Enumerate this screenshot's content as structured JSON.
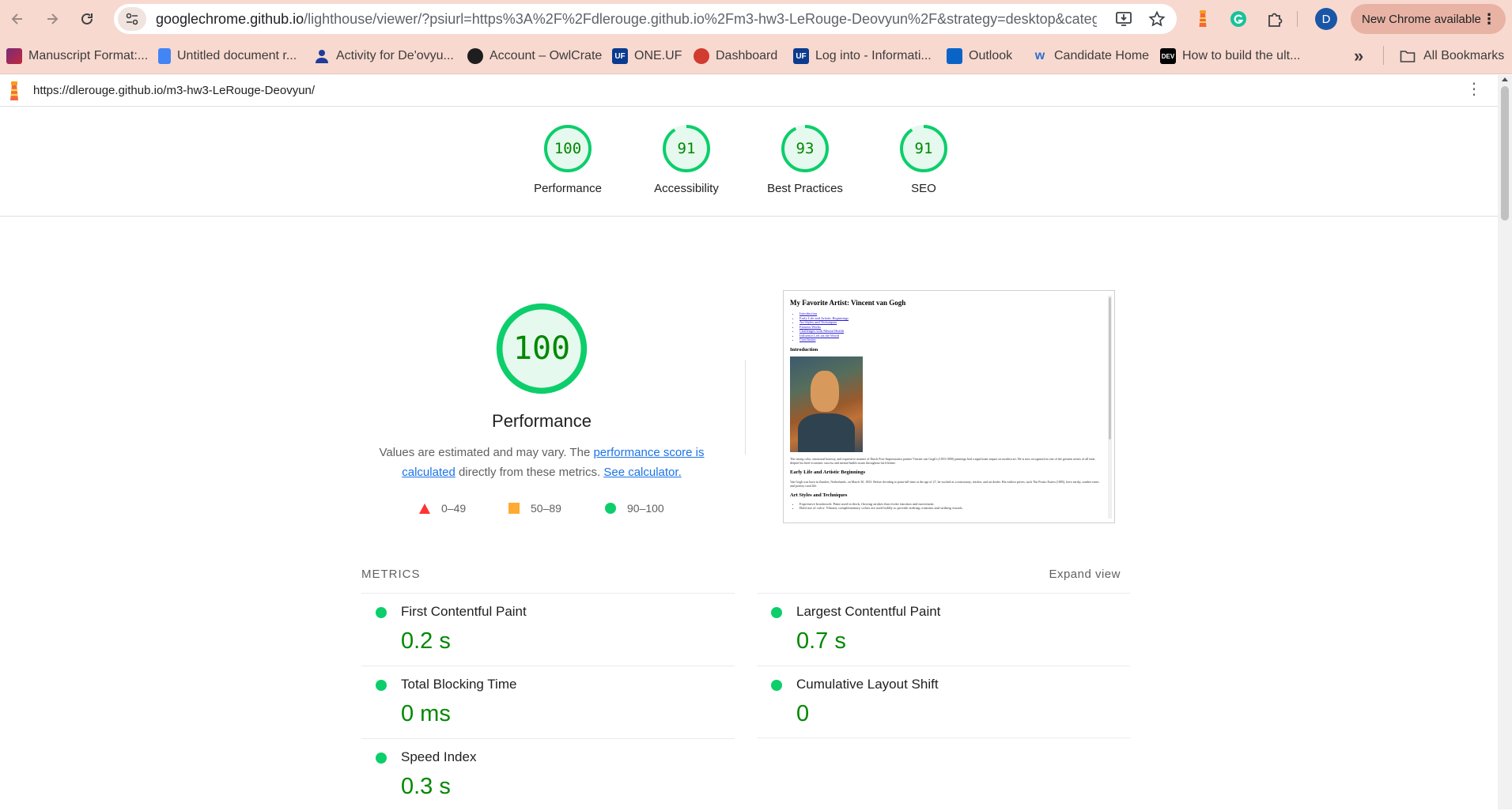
{
  "browser": {
    "url_host": "googlechrome.github.io",
    "url_path": "/lighthouse/viewer/?psiurl=https%3A%2F%2Fdlerouge.github.io%2Fm3-hw3-LeRouge-Deovyun%2F&strategy=desktop&category...",
    "profile_initial": "D",
    "update_label": "New Chrome available"
  },
  "bookmarks": {
    "items": [
      {
        "label": "Manuscript Format:..."
      },
      {
        "label": "Untitled document r..."
      },
      {
        "label": "Activity for De'ovyu..."
      },
      {
        "label": "Account – OwlCrate"
      },
      {
        "label": "ONE.UF"
      },
      {
        "label": "Dashboard"
      },
      {
        "label": "Log into - Informati..."
      },
      {
        "label": "Outlook"
      },
      {
        "label": "Candidate Home"
      },
      {
        "label": "How to build the ult..."
      }
    ],
    "overflow": "»",
    "all_bookmarks": "All Bookmarks",
    "fav_one_uf": "UF",
    "fav_log": "UF",
    "fav_dev": "DEV"
  },
  "viewer": {
    "report_url": "https://dlerouge.github.io/m3-hw3-LeRouge-Deovyun/"
  },
  "categories": [
    {
      "score": "100",
      "label": "Performance",
      "value": 100
    },
    {
      "score": "91",
      "label": "Accessibility",
      "value": 91
    },
    {
      "score": "93",
      "label": "Best Practices",
      "value": 93
    },
    {
      "score": "91",
      "label": "SEO",
      "value": 91
    }
  ],
  "performance": {
    "score": "100",
    "value": 100,
    "title": "Performance",
    "desc_prefix": "Values are estimated and may vary. The ",
    "desc_link1": "performance score is calculated",
    "desc_middle": " directly from these metrics. ",
    "desc_link2": "See calculator.",
    "legend": [
      {
        "range": "0–49",
        "color": "#ff3333"
      },
      {
        "range": "50–89",
        "color": "#ffaa33"
      },
      {
        "range": "90–100",
        "color": "#0cce6b"
      }
    ]
  },
  "screenshot": {
    "title": "My Favorite Artist: Vincent van Gogh",
    "toc": [
      "Introduction",
      "Early Life and Artistic Beginnings",
      "Art Styles and Techniques",
      "Famous Works",
      "Challenges with Mental Health",
      "Influence Left on the World",
      "Conclusion"
    ],
    "intro_heading": "Introduction",
    "intro_text": "The strong color, emotional honesty, and expressive manner of Dutch Post-Impressionist painter Vincent van Gogh's (1853-1890) paintings had a significant impact on modern art. He is now recognized as one of the greatest artists of all time, despite his brief economic success and mental health issues throughout his lifetime.",
    "early_heading": "Early Life and Artistic Beginnings",
    "early_text": "Van Gogh was born in Zundert, Netherlands, on March 30, 1853. Before deciding to paint full-time at the age of 27, he worked as a missionary, teacher, and art dealer. His earliest pieces, such The Potato Eaters (1885), have earthy, somber tones and portray rural life.",
    "styles_heading": "Art Styles and Techniques",
    "styles_items": [
      "Expressive brushwork: Paint used in thick, flowing strokes that evoke emotion and movement.",
      "Bold use of color: Vibrant, complementary colors are used boldly to provide striking contrasts and striking visuals."
    ]
  },
  "metrics": {
    "title": "METRICS",
    "expand": "Expand view",
    "items": [
      {
        "name": "First Contentful Paint",
        "value": "0.2 s"
      },
      {
        "name": "Largest Contentful Paint",
        "value": "0.7 s"
      },
      {
        "name": "Total Blocking Time",
        "value": "0 ms"
      },
      {
        "name": "Cumulative Layout Shift",
        "value": "0"
      },
      {
        "name": "Speed Index",
        "value": "0.3 s"
      }
    ]
  },
  "colors": {
    "pass": "#0cce6b",
    "pass_text": "#008800",
    "chrome": "#f8d9cf"
  }
}
